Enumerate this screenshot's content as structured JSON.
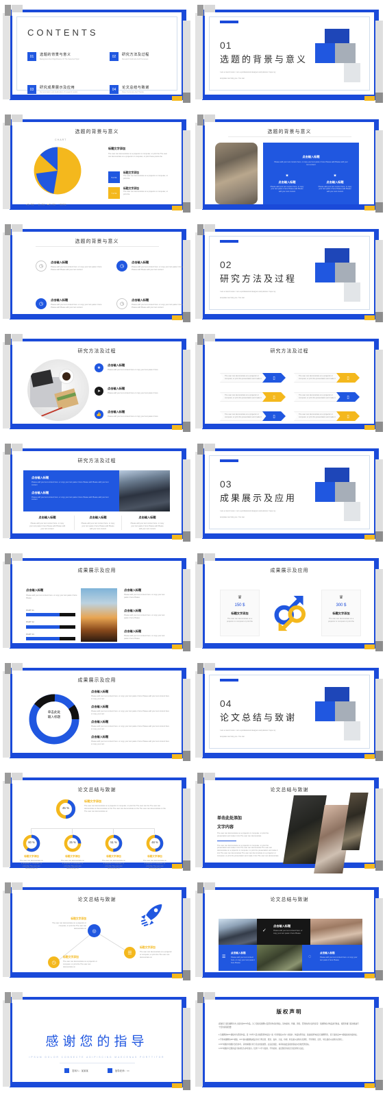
{
  "deck": {
    "theme": {
      "primary_blue": "#2057e0",
      "frame_blue": "#1a4ad9",
      "accent_yellow": "#f4b81d",
      "gray": "#a6aeb8",
      "dark": "#1a1a1a"
    },
    "slides": [
      {
        "id": "contents",
        "heading": "CONTENTS",
        "items": [
          {
            "num": "01",
            "cn": "选题的背景与意义",
            "en": "Background And Significance Of The Selected Topic"
          },
          {
            "num": "02",
            "cn": "研究方法及过程",
            "en": "Research Methods And Processes"
          },
          {
            "num": "03",
            "cn": "研究成果展示及应用",
            "en": "Demonstration and Application of research results"
          },
          {
            "num": "04",
            "cn": "论文总结与致谢",
            "en": "Paper Summary And Thanks"
          }
        ]
      },
      {
        "id": "section-01",
        "num": "01",
        "cn": "选题的背景与意义",
        "sub1": "I am a round moon. I am a professional designer and planner. hope my",
        "sub2": "template can help you. You can"
      },
      {
        "id": "pie-chart",
        "title": "选题的背景与意义",
        "chart_label": "CHART",
        "body_head": "标题文字添加",
        "body_text": "The user can demonstrate on a projector or computer, or print the The user can demonstrate on a projector or computer, or print these points the",
        "stats": [
          {
            "value": "5.4 %",
            "head": "标题文字添加",
            "text": "The user can demonstrate on a projector or computer, or print the"
          },
          {
            "value": "7.2 %",
            "head": "标题文字添加",
            "text": "The user can demonstrate on a projector or computer, or print the"
          }
        ],
        "legend": [
          "第一季度",
          "第二季度",
          "第三季度",
          "第四季度"
        ]
      },
      {
        "id": "photo-blue-panel",
        "title": "选题的背景与意义",
        "panel_head": "点击输入标题",
        "panel_text": "Please add your text content here. or copy your text paste it here Please add Please add your text content",
        "cols": [
          {
            "head": "点击输入标题",
            "text": "Please add your text content here. or copy your text paste it here Please add Please add your text content"
          },
          {
            "head": "点击输入标题",
            "text": "Please add your text content here. or copy your text paste it here Please add Please add your text content"
          }
        ]
      },
      {
        "id": "four-icons",
        "title": "选题的背景与意义",
        "items": [
          {
            "head": "点击输入标题",
            "text": "Please add your text content here. or copy your text paste it here Please add Please add your text content"
          },
          {
            "head": "点击输入标题",
            "text": "Please add your text content here. or copy your text paste it here Please add Please add your text content"
          },
          {
            "head": "点击输入标题",
            "text": "Please add your text content here. or copy your text paste it here Please add Please add your text content"
          },
          {
            "head": "点击输入标题",
            "text": "Please add your text content here. or copy your text paste it here Please add Please add your text content"
          }
        ]
      },
      {
        "id": "section-02",
        "num": "02",
        "cn": "研究方法及过程",
        "sub1": "I am a round moon. I am a professional designer and planner. hope my",
        "sub2": "template can help you. You can"
      },
      {
        "id": "desk-photo-list",
        "title": "研究方法及过程",
        "items": [
          {
            "head": "点击输入标题",
            "text": "Please add your text content here or copy your text paste it here"
          },
          {
            "head": "点击输入标题",
            "text": "Please add your text content here or copy your text paste it here"
          },
          {
            "head": "点击输入标题",
            "text": "Please add your text content here or copy your text paste it here"
          }
        ]
      },
      {
        "id": "chevrons",
        "title": "研究方法及过程",
        "rows": [
          {
            "text": "The user can demonstrate on a projector or computer, or print the presentation and make it",
            "color": "blue"
          },
          {
            "text": "The user can demonstrate on a projector or computer, or print the presentation and make it",
            "color": "yellow"
          },
          {
            "text": "The user can demonstrate on a projector or computer, or print the presentation and make it",
            "color": "yellow"
          },
          {
            "text": "The user can demonstrate on a projector or computer, or print the presentation and make it",
            "color": "blue"
          },
          {
            "text": "The user can demonstrate on a projector or computer, or print the presentation and make it",
            "color": "blue"
          },
          {
            "text": "The user can demonstrate on a projector or computer, or print the presentation and make it",
            "color": "yellow"
          }
        ]
      },
      {
        "id": "teamwork",
        "title": "研究方法及过程",
        "panel": [
          {
            "head": "点击输入标题",
            "text": "Please add your text content here. or copy your text paste it here Please add Please add your text content"
          },
          {
            "head": "点击输入标题",
            "text": "Please add your text content here. or copy your text paste it here Please add Please add your text content"
          }
        ],
        "cols": [
          {
            "head": "点击输入标题",
            "text": "Please add your text content here. or copy your text paste it here Please add Please add your text content"
          },
          {
            "head": "点击输入标题",
            "text": "Please add your text content here. or copy your text paste it here Please add Please add your text content"
          },
          {
            "head": "点击输入标题",
            "text": "Please add your text content here. or copy your text paste it here Please add Please add your text content"
          }
        ]
      },
      {
        "id": "section-03",
        "num": "03",
        "cn": "成果展示及应用",
        "sub1": "I am a round moon. I am a professional designer and planner. hope my",
        "sub2": "template can help you. You can"
      },
      {
        "id": "progress-photo",
        "title": "成果展示及应用",
        "left_head": "点击输入标题",
        "left_text": "Please add your text content here. or copy your text paste it here Please",
        "bars": [
          {
            "label": "PART 01",
            "value": 68
          },
          {
            "label": "PART 02",
            "value": 68
          },
          {
            "label": "PART 03",
            "value": 68
          }
        ],
        "right_items": [
          {
            "head": "点击输入标题",
            "text": "Please add your text content here. or copy your text paste it here Please"
          },
          {
            "head": "点击输入标题",
            "text": "Please add your text content here. or copy your text paste it here Please"
          },
          {
            "head": "点击输入标题",
            "text": "Please add your text content here. or copy your text paste it here Please"
          }
        ]
      },
      {
        "id": "price-cards",
        "title": "成果展示及应用",
        "cards": [
          {
            "price": "150 $",
            "head": "标题文字添加",
            "text": "The user can demonstrate on a projector or computer or print the"
          },
          {
            "price": "300 $",
            "head": "标题文字添加",
            "text": "The user can demonstrate on a projector or computer or print the"
          }
        ]
      },
      {
        "id": "donut-list",
        "title": "成果展示及应用",
        "donut_center_l1": "单击此处",
        "donut_center_l2": "输入标题",
        "items": [
          {
            "head": "点击输入标题",
            "text": "Please add your text content here. or copy your text paste it here Please add your text content here or copy your text"
          },
          {
            "head": "点击输入标题",
            "text": "Please add your text content here. or copy your text paste it here Please add your text content here or copy your text"
          },
          {
            "head": "点击输入标题",
            "text": "Please add your text content here. or copy your text paste it here Please add your text content here or copy your text"
          },
          {
            "head": "点击输入标题",
            "text": "Please add your text content here. or copy your text paste it here Please add your text content here or copy your text"
          }
        ]
      },
      {
        "id": "section-04",
        "num": "04",
        "cn": "论文总结与致谢",
        "sub1": "I am a round moon. I am a professional designer and planner. hope my",
        "sub2": "template can help you. You can"
      },
      {
        "id": "donut-tree",
        "title": "论文总结与致谢",
        "top": {
          "percent": "45 %",
          "head": "标题文字添加",
          "text": "The user can demonstrate on a projector or computer, or print the The user can the The user can demonstrate on demonstrate on the The user can demonstrate on the The user can demonstrate on the The user can demonstrate on"
        },
        "nodes": [
          {
            "percent": "60 %",
            "head": "标题文字添加",
            "text": "The user can demonstrate on a projector or computer, or print the The user can demonstrate on"
          },
          {
            "percent": "25 %",
            "head": "标题文字添加",
            "text": "The user can demonstrate on a projector or computer, or print the The user can demonstrate on"
          },
          {
            "percent": "51 %",
            "head": "标题文字添加",
            "text": "The user can demonstrate on a projector or computer, or print the The user can demonstrate on"
          },
          {
            "percent": "48 %",
            "head": "标题文字添加",
            "text": "The user can demonstrate on a projector or computer, or print the The user can demonstrate on"
          }
        ]
      },
      {
        "id": "diagonal-photos",
        "title": "论文总结与致谢",
        "head_l1": "单击此处添加",
        "head_l2": "文字内容",
        "text1": "The user can demonstrate on a projector or computer, or print the presentation and make it into The user can demonstrate",
        "text2": "The user can demonstrate on a projector or computer, or print the presentation and make it into The user can demonstrate The user can demonstrate on a projector or computer, or print the presentation and make it into The user can demonstrate The user can demonstrate on a projector or computer, or print the presentation and make it into The user can demonstrate"
      },
      {
        "id": "rocket-nodes",
        "title": "论文总结与致谢",
        "nodes": [
          {
            "head": "标题文字添加",
            "text": "The user can demonstrate on a projector or computer, or print the The user can demonstrate on"
          },
          {
            "head": "标题文字添加",
            "text": "The user can demonstrate on a projector or computer, or print the The user can demonstrate on"
          },
          {
            "head": "标题文字添加",
            "text": "The user can demonstrate on a projector or computer, or print the The user can demonstrate on"
          }
        ]
      },
      {
        "id": "photo-grid",
        "title": "论文总结与致谢",
        "cells": [
          {
            "head": "点击输入标题",
            "text": "Please add your text content here. or copy your text paste it here Please"
          },
          {
            "head": "点击输入标题",
            "text": "Please add your text content here. or copy your text paste it here Please"
          },
          {
            "head": "点击输入标题",
            "text": "Please add your text content here. or copy your text paste it here Please"
          }
        ]
      },
      {
        "id": "thanks",
        "heading": "感谢您的指导",
        "sub": "IPSUM DOLOR CONSECTE ADIPISCING MAECENAS PORTTITOR",
        "tags": [
          {
            "label": "答辩人：某某某"
          },
          {
            "label": "指导老师：××"
          }
        ]
      },
      {
        "id": "copyright",
        "heading": "版权声明",
        "p1": "感谢您下载包图网平台上提供的PPT作品，为了您和包图网以及原创作者的利益，请勿复制、传播、销售，否则将承担法律责任！包图网将对作品进行维权，按照传播下载次数进行十倍的索取赔偿！",
        "p2": "1.包图网的PPT模板均为原创作品，受《中华人民共和国著作权法》和《世界版权公约》的保护，作品的所有权、版权和著作权归包图网所有，您下载的是PPT模板素材的使用权。",
        "p3": "2.不得将图网的PPT模板、PPT素材或图稿成设计用于再出售、租赁、发布、分发、印刷、转卖或以其他方式销售、不得传授、出售、转让或者以其他方式转让。",
        "p4": "3.PPT模板中的图片仅供参考，请勿将图片用于商业用途或售，如违反规定，将承担由此造成的版权纠纷和经济损失。",
        "p5": "4.PPT模板中出现的设计素材仅为参考展示，仅供个人学习使用，不得商用，如出现任何的安全使用作为违反。"
      }
    ]
  }
}
